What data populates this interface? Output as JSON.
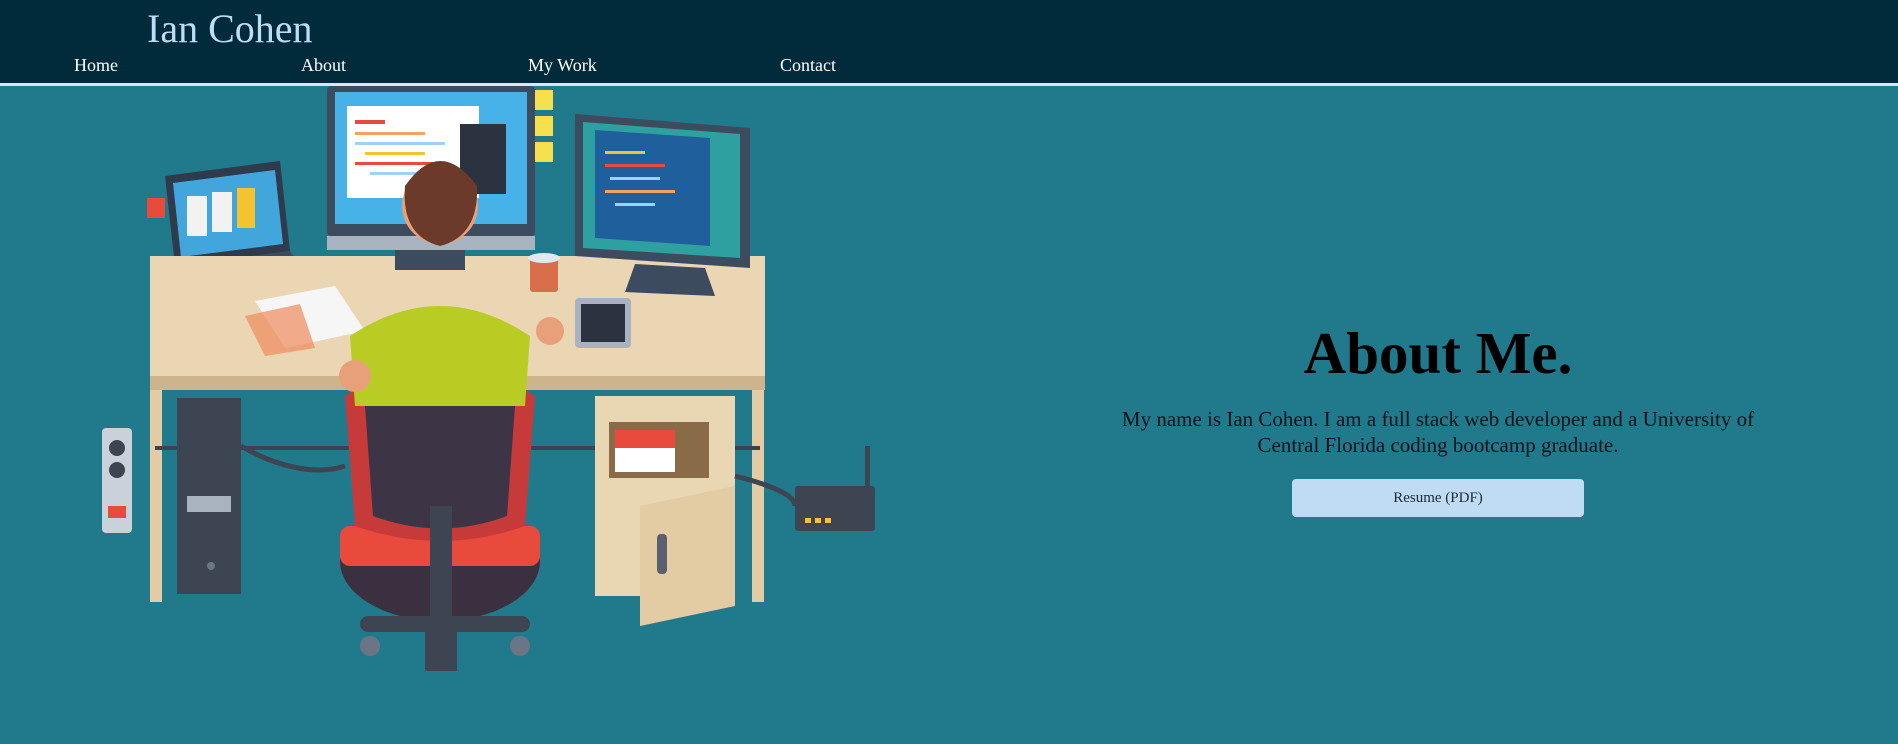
{
  "header": {
    "title": "Ian Cohen",
    "nav": [
      {
        "label": "Home"
      },
      {
        "label": "About"
      },
      {
        "label": "My Work"
      },
      {
        "label": "Contact"
      }
    ]
  },
  "about": {
    "heading": "About Me.",
    "description": "My name is Ian Cohen. I am a full stack web developer and a University of Central Florida coding bootcamp graduate.",
    "resume_label": "Resume (PDF)"
  },
  "colors": {
    "background": "#217a8c",
    "header": "#012b3a",
    "title": "#bfdcf7",
    "button": "#c0dcf5"
  },
  "illustration": "developer-at-desk-illustration"
}
